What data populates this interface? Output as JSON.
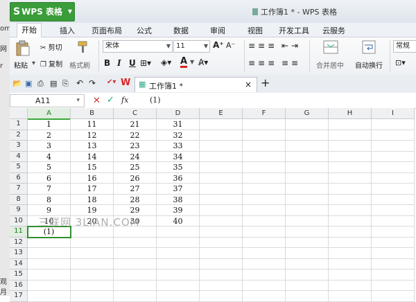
{
  "app": {
    "button_label": "WPS 表格",
    "window_title": "工作簿1 * - WPS 表格",
    "accent": "#3a9d3a"
  },
  "left_background": {
    "items": [
      "om",
      "网",
      "r",
      "观月"
    ]
  },
  "ribbon_tabs": [
    "开始",
    "插入",
    "页面布局",
    "公式",
    "数据",
    "审阅",
    "视图",
    "开发工具",
    "云服务"
  ],
  "ribbon": {
    "paste": "粘贴",
    "cut": "剪切",
    "copy": "复制",
    "format_painter": "格式刷",
    "font_name": "宋体",
    "font_size": "11",
    "bold": "B",
    "italic": "I",
    "underline": "U",
    "merge_center": "合并居中",
    "wrap_text": "自动换行",
    "number_format": "常规"
  },
  "doc_tab": {
    "label": "工作簿1 *"
  },
  "formula_bar": {
    "name_box": "A11",
    "fx": "fx",
    "value": "(1)"
  },
  "columns": [
    "A",
    "B",
    "C",
    "D",
    "E",
    "F",
    "G",
    "H",
    "I"
  ],
  "rows": [
    "1",
    "2",
    "3",
    "4",
    "5",
    "6",
    "7",
    "8",
    "9",
    "10",
    "11",
    "12",
    "13",
    "14",
    "15",
    "16",
    "17"
  ],
  "cells": [
    [
      "1",
      "11",
      "21",
      "31"
    ],
    [
      "2",
      "12",
      "22",
      "32"
    ],
    [
      "3",
      "13",
      "23",
      "33"
    ],
    [
      "4",
      "14",
      "24",
      "34"
    ],
    [
      "5",
      "15",
      "25",
      "35"
    ],
    [
      "6",
      "16",
      "26",
      "36"
    ],
    [
      "7",
      "17",
      "27",
      "37"
    ],
    [
      "8",
      "18",
      "28",
      "38"
    ],
    [
      "9",
      "19",
      "29",
      "39"
    ],
    [
      "10",
      "20",
      "30",
      "40"
    ],
    [
      "(1)",
      "",
      "",
      ""
    ]
  ],
  "active_cell": "A11",
  "watermark": "三联网 3LIAN.COM"
}
